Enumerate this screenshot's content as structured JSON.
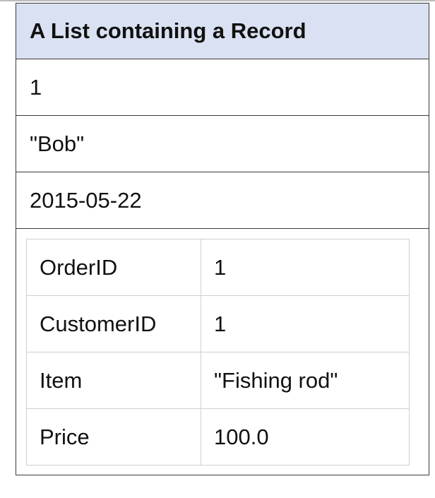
{
  "outer_table": {
    "title": "A List containing a Record",
    "items": [
      "1",
      "\"Bob\"",
      "2015-05-22"
    ]
  },
  "record": {
    "fields": [
      {
        "name": "OrderID",
        "value": "1"
      },
      {
        "name": "CustomerID",
        "value": "1"
      },
      {
        "name": "Item",
        "value": "\"Fishing rod\""
      },
      {
        "name": "Price",
        "value": "100.0"
      }
    ]
  }
}
